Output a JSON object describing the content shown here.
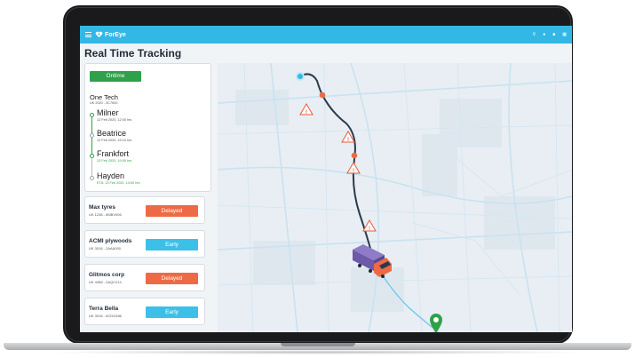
{
  "app": {
    "logo_text": "ForEye"
  },
  "topbar": {
    "icons": [
      "search-icon",
      "bell-icon",
      "mail-icon",
      "grid-icon"
    ]
  },
  "page": {
    "title": "Real Time Tracking"
  },
  "shipment": {
    "status": "Ontime",
    "company": "One Tech",
    "vehicle": "UK 2020 - 3C7600",
    "stops": [
      {
        "name": "Milner",
        "time": "12 Feb 2020, 12:00 hrs"
      },
      {
        "name": "Beatrice",
        "time": "12 Feb 2020, 15:10 hrs"
      },
      {
        "name": "Frankfort",
        "time": "13 Feb 2020, 19:50 hrs"
      },
      {
        "name": "Hayden",
        "time": "ETA: 13 Feb 2020, 14:00 hrs"
      }
    ]
  },
  "orders": [
    {
      "name": "Max tyres",
      "id": "UK 1238 - 6MBV006",
      "status": "Delayed"
    },
    {
      "name": "ACMI plywoods",
      "id": "UK 3018 - 2AAA000",
      "status": "Early"
    },
    {
      "name": "Glitmos corp",
      "id": "UK 4358 - 2AQC214",
      "status": "Delayed"
    },
    {
      "name": "Terra Bella",
      "id": "UK 3018 - 6CDG486",
      "status": "Early"
    }
  ],
  "colors": {
    "topbar": "#33b8e6",
    "ontime": "#2fa14a",
    "delayed": "#ee6a45",
    "early": "#3cc0e8",
    "route_done": "#2b3a4a",
    "route_pending": "#6cc6ee",
    "alert": "#e8593a"
  }
}
